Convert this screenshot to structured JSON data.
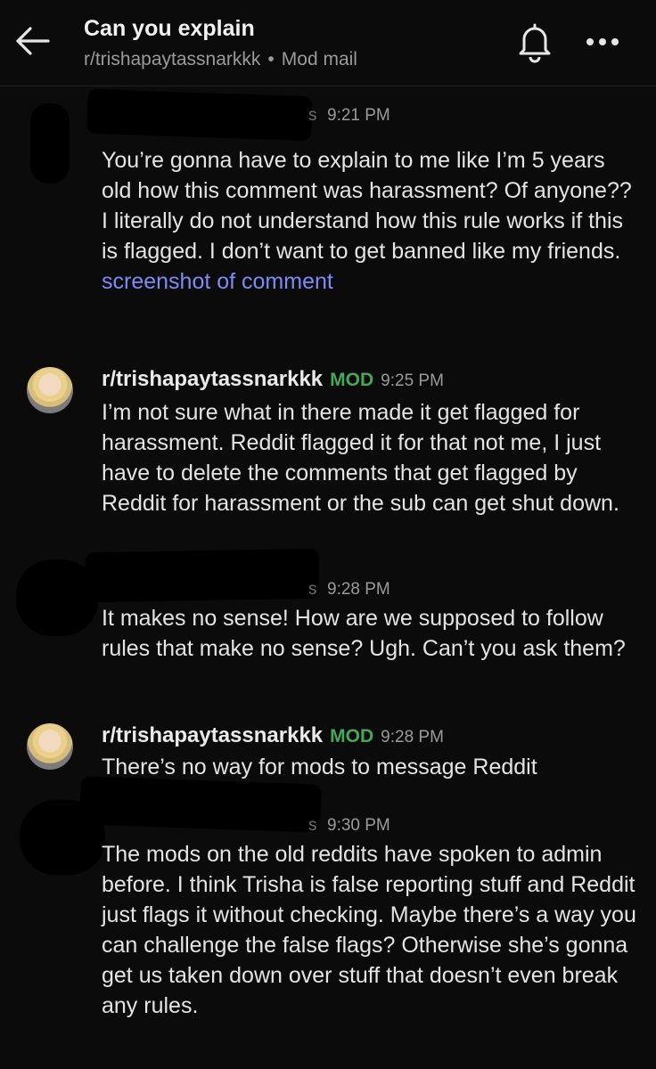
{
  "header": {
    "title": "Can you explain",
    "community": "r/trishapaytassnarkkk",
    "separator": "•",
    "section": "Mod mail"
  },
  "messages": [
    {
      "time": "9:21 PM",
      "name_tail": "s",
      "body": "You’re gonna have to explain to me like I’m 5 years old how this comment was harassment? Of anyone?? I literally do not understand how this rule works if this is flagged. I don’t want to get banned like my friends.",
      "link": "screenshot of comment"
    },
    {
      "author": "r/trishapaytassnarkkk",
      "badge": "MOD",
      "time": "9:25 PM",
      "body": "I’m not sure what in there made it get flagged for harassment. Reddit flagged it for that not me, I just have to delete the comments that get flagged by Reddit for harassment or the sub can get shut down."
    },
    {
      "time": "9:28 PM",
      "name_tail": "s",
      "body": "It makes no sense! How are we supposed to follow rules that make no sense? Ugh. Can’t you ask them?"
    },
    {
      "author": "r/trishapaytassnarkkk",
      "badge": "MOD",
      "time": "9:28 PM",
      "body": "There’s no way for mods to message Reddit"
    },
    {
      "time": "9:30 PM",
      "name_tail": "s",
      "body": "The mods on the old reddits have spoken to admin before. I think Trisha is false reporting stuff and Reddit just flags it without checking. Maybe there’s a way you can challenge the false flags? Otherwise she’s gonna get us taken down over stuff that doesn’t even break any rules."
    }
  ],
  "colors": {
    "background": "#0b0b0b",
    "mod_badge": "#46a758",
    "link": "#7d8bf5"
  },
  "icons": [
    "back-arrow-icon",
    "bell-icon",
    "more-icon"
  ]
}
